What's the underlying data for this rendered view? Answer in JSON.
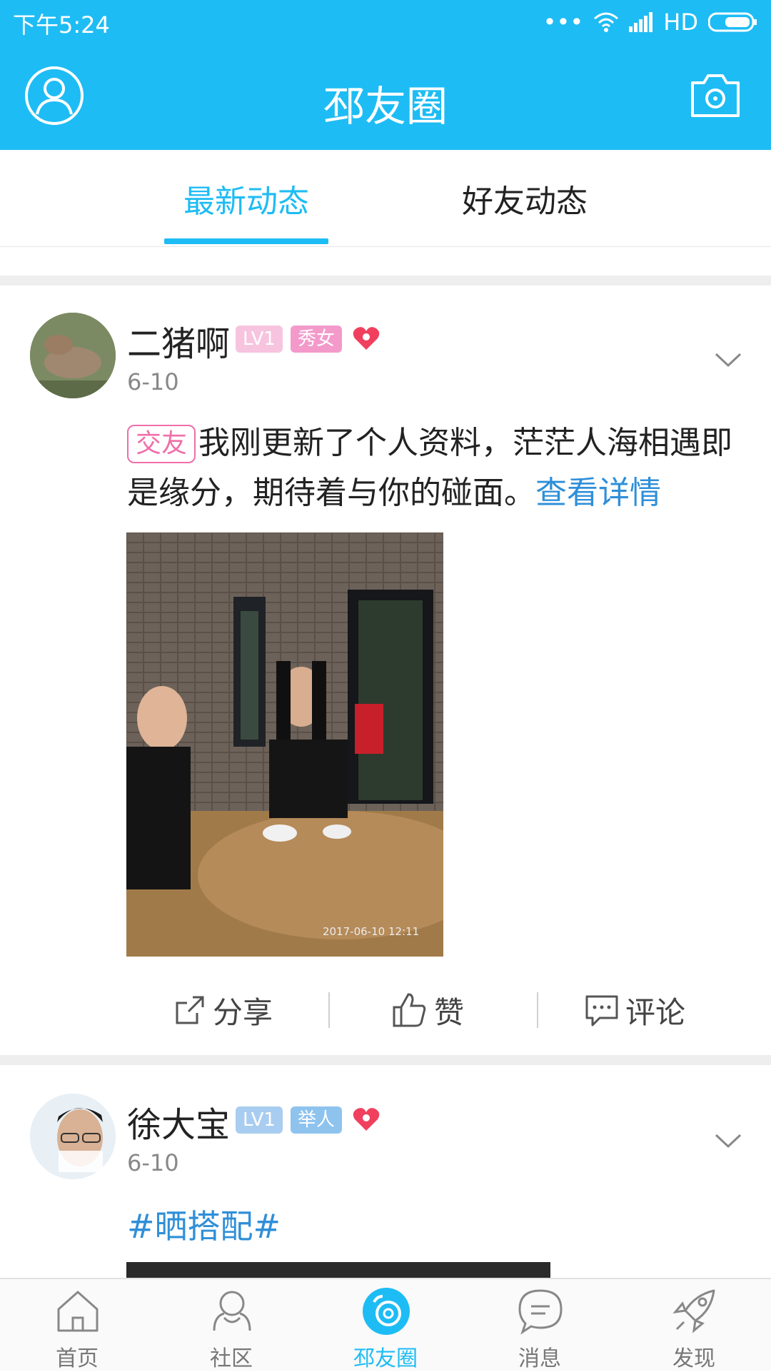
{
  "status_bar": {
    "time": "下午5:24",
    "network": "HD"
  },
  "header": {
    "title": "邳友圈"
  },
  "tabs": [
    {
      "label": "最新动态",
      "active": true
    },
    {
      "label": "好友动态",
      "active": false
    }
  ],
  "posts": [
    {
      "username": "二猪啊",
      "level": "LV1",
      "badge": "秀女",
      "date": "6-10",
      "tag": "交友",
      "text": "我刚更新了个人资料，茫茫人海相遇即是缘分，期待着与你的碰面。",
      "more_link": "查看详情",
      "photo_timestamp": "2017-06-10 12:11"
    },
    {
      "username": "徐大宝",
      "level": "LV1",
      "badge": "举人",
      "date": "6-10",
      "hashtag": "#晒搭配#"
    }
  ],
  "actions": {
    "share": "分享",
    "like": "赞",
    "comment": "评论"
  },
  "bottom_nav": [
    {
      "label": "首页",
      "icon": "home-icon"
    },
    {
      "label": "社区",
      "icon": "community-icon"
    },
    {
      "label": "邳友圈",
      "icon": "friends-circle-icon",
      "active": true
    },
    {
      "label": "消息",
      "icon": "message-icon"
    },
    {
      "label": "发现",
      "icon": "rocket-icon"
    }
  ],
  "colors": {
    "brand": "#1ebcf4",
    "link": "#2f8fd8",
    "badge_pink": "#f39acb",
    "badge_blue": "#8ec3ee",
    "heart": "#f0405e"
  }
}
